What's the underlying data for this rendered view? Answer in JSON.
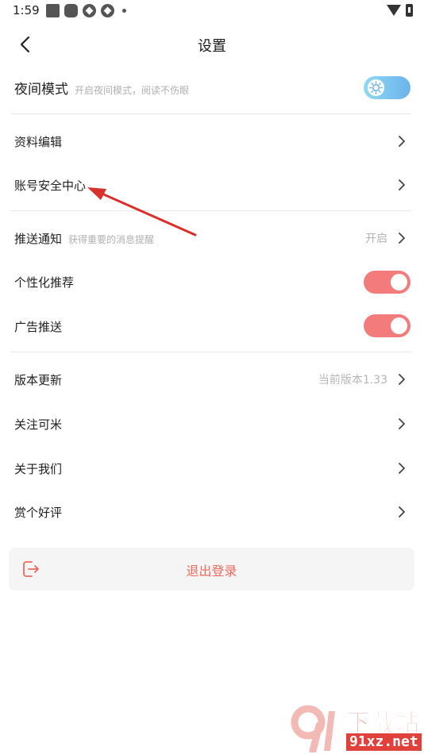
{
  "status_bar": {
    "time": "1:59"
  },
  "header": {
    "title": "设置"
  },
  "night_mode": {
    "label": "夜间模式",
    "subtitle": "开启夜间模式，阅读不伤眼"
  },
  "rows": {
    "profile_edit": "资料编辑",
    "account_security": "账号安全中心",
    "push": {
      "label": "推送通知",
      "subtitle": "获得重要的消息提醒",
      "value": "开启"
    },
    "personalized": "个性化推荐",
    "ads": "广告推送",
    "version": {
      "label": "版本更新",
      "value": "当前版本1.33"
    },
    "follow": "关注可米",
    "about": "关于我们",
    "rate": "赏个好评"
  },
  "logout": {
    "label": "退出登录"
  },
  "watermark": {
    "title": "下载站",
    "domain": "91xz.net"
  },
  "colors": {
    "switch_on": "#f37b7b",
    "logout_text": "#ee6a5c",
    "annotation_arrow": "#d9302c",
    "night_toggle": "#6bb3ec"
  }
}
